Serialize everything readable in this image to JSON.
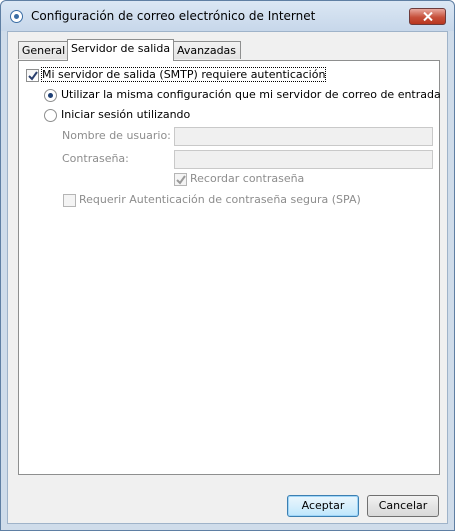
{
  "window": {
    "title": "Configuración de correo electrónico de Internet",
    "icon": "outlook-app-icon"
  },
  "tabs": [
    {
      "label": "General",
      "active": false
    },
    {
      "label": "Servidor de salida",
      "active": true
    },
    {
      "label": "Avanzadas",
      "active": false
    }
  ],
  "smtp_auth": {
    "label": "Mi servidor de salida (SMTP) requiere autenticación",
    "checked": true
  },
  "auth_options": {
    "use_same": {
      "label": "Utilizar la misma configuración que mi servidor de correo de entrada",
      "selected": true
    },
    "log_on_using": {
      "label": "Iniciar sesión utilizando",
      "selected": false
    }
  },
  "credentials": {
    "username_label": "Nombre de usuario:",
    "username_value": "",
    "password_label": "Contraseña:",
    "password_value": "",
    "remember_label": "Recordar contraseña",
    "remember_checked": true,
    "spa_label": "Requerir Autenticación de contraseña segura (SPA)",
    "spa_checked": false
  },
  "buttons": {
    "ok": "Aceptar",
    "cancel": "Cancelar"
  }
}
